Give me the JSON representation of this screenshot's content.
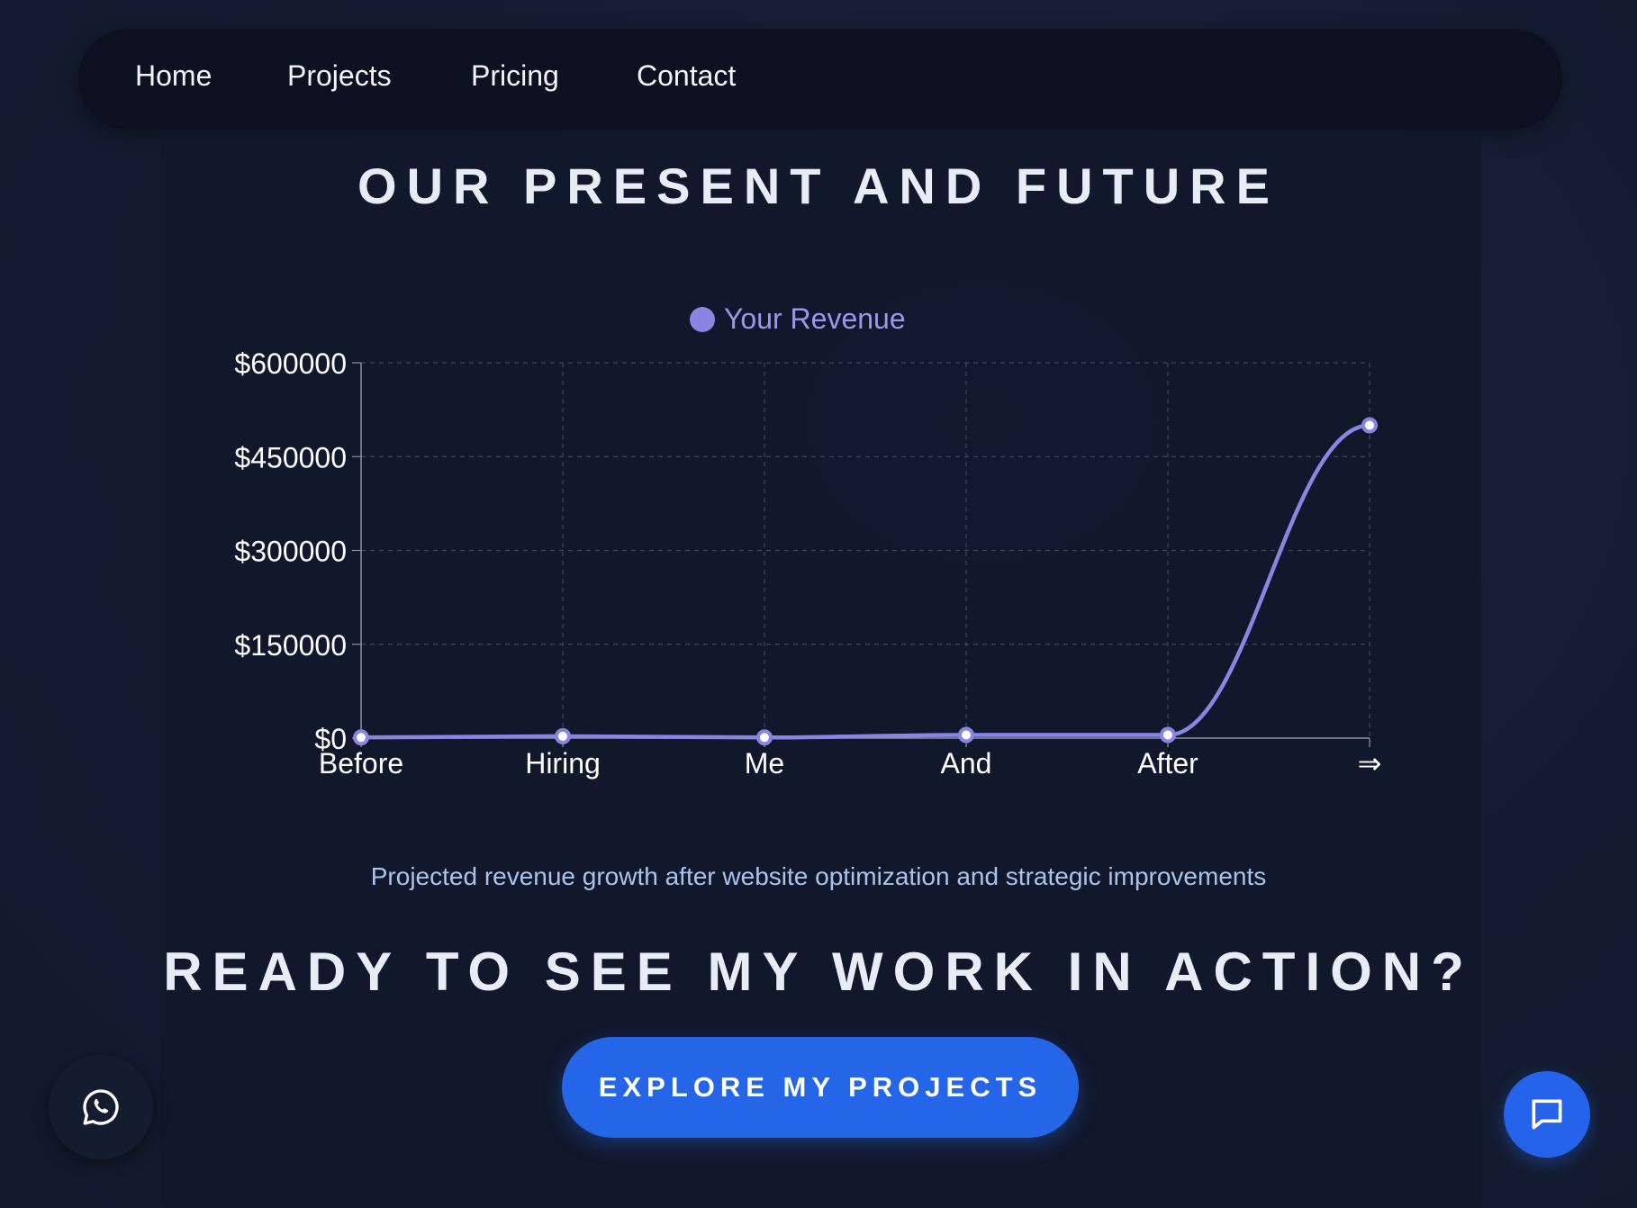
{
  "nav": {
    "items": [
      {
        "label": "Home"
      },
      {
        "label": "Projects"
      },
      {
        "label": "Pricing"
      },
      {
        "label": "Contact"
      }
    ]
  },
  "section": {
    "title": "OUR PRESENT AND FUTURE",
    "caption": "Projected revenue growth after website optimization and strategic improvements"
  },
  "cta": {
    "heading": "READY TO SEE MY WORK IN ACTION?",
    "button_label": "EXPLORE MY PROJECTS"
  },
  "floating": {
    "whatsapp_icon": "whatsapp-icon",
    "chat_icon": "chat-bubble-icon"
  },
  "chart_data": {
    "type": "line",
    "title": "",
    "xlabel": "",
    "ylabel": "",
    "categories": [
      "Before",
      "Hiring",
      "Me",
      "And",
      "After",
      "⇒"
    ],
    "series": [
      {
        "name": "Your Revenue",
        "values": [
          1000,
          3000,
          1000,
          5000,
          5000,
          500000
        ],
        "color": "#8885e3"
      }
    ],
    "yticks": [
      "$600000",
      "$450000",
      "$300000",
      "$150000",
      "$0"
    ],
    "ytick_values": [
      600000,
      450000,
      300000,
      150000,
      0
    ],
    "ylim": [
      0,
      600000
    ],
    "grid": true,
    "legend_position": "top-center"
  }
}
